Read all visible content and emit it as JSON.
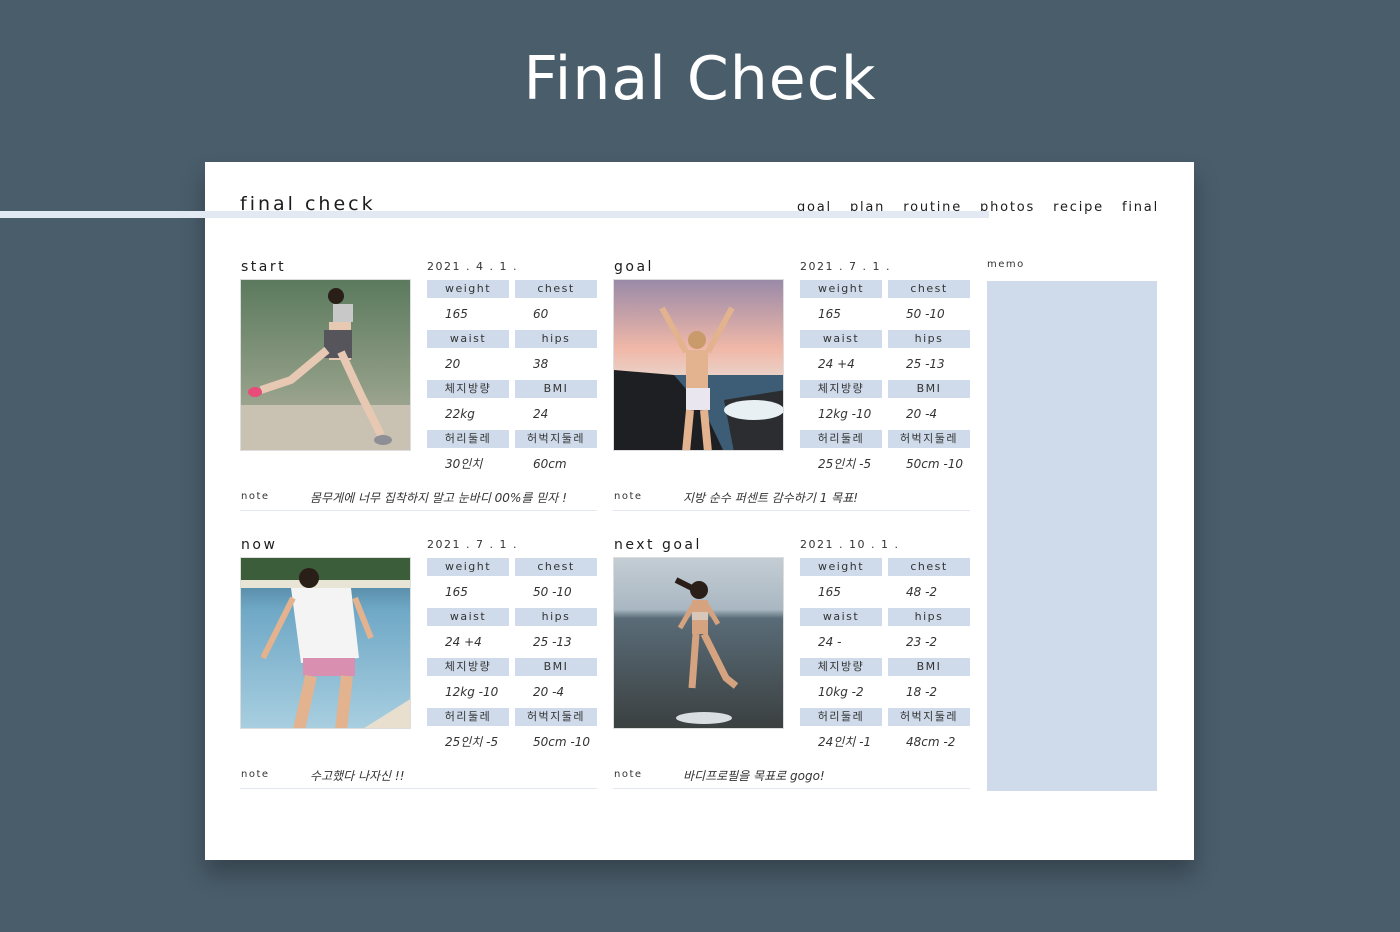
{
  "header": {
    "title": "Final Check"
  },
  "sheet": {
    "title": "final check",
    "nav": [
      "goal",
      "plan",
      "routine",
      "photos",
      "recipe",
      "final"
    ],
    "memo_label": "memo"
  },
  "colors": {
    "background": "#4a5d6b",
    "accent": "#cfdbea",
    "band": "#e3e9f2"
  },
  "sections": [
    {
      "title": "start",
      "date": "2021 . 4 . 1 .",
      "labels": [
        "weight",
        "chest",
        "waist",
        "hips",
        "체지방량",
        "BMI",
        "허리둘레",
        "허벅지둘레"
      ],
      "values": [
        "165",
        "60",
        "20",
        "38",
        "22kg",
        "24",
        "30인치",
        "60cm"
      ],
      "note_label": "note",
      "note": "몸무게에 너무 집착하지 말고 눈바디 00%를 믿자 !"
    },
    {
      "title": "goal",
      "date": "2021 . 7 . 1 .",
      "labels": [
        "weight",
        "chest",
        "waist",
        "hips",
        "체지방량",
        "BMI",
        "허리둘레",
        "허벅지둘레"
      ],
      "values": [
        "165",
        "50  -10",
        "24  +4",
        "25  -13",
        "12kg  -10",
        "20  -4",
        "25인치  -5",
        "50cm  -10"
      ],
      "note_label": "note",
      "note": "지방 순수 퍼센트 감수하기 1 목표!"
    },
    {
      "title": "now",
      "date": "2021 . 7 . 1 .",
      "labels": [
        "weight",
        "chest",
        "waist",
        "hips",
        "체지방량",
        "BMI",
        "허리둘레",
        "허벅지둘레"
      ],
      "values": [
        "165",
        "50  -10",
        "24  +4",
        "25  -13",
        "12kg  -10",
        "20  -4",
        "25인치  -5",
        "50cm  -10"
      ],
      "note_label": "note",
      "note": "수고했다 나자신 !!"
    },
    {
      "title": "next goal",
      "date": "2021 . 10 . 1 .",
      "labels": [
        "weight",
        "chest",
        "waist",
        "hips",
        "체지방량",
        "BMI",
        "허리둘레",
        "허벅지둘레"
      ],
      "values": [
        "165",
        "48  -2",
        "24  -",
        "23  -2",
        "10kg  -2",
        "18  -2",
        "24인치  -1",
        "48cm  -2"
      ],
      "note_label": "note",
      "note": "바디프로필을 목표로 gogo!"
    }
  ]
}
